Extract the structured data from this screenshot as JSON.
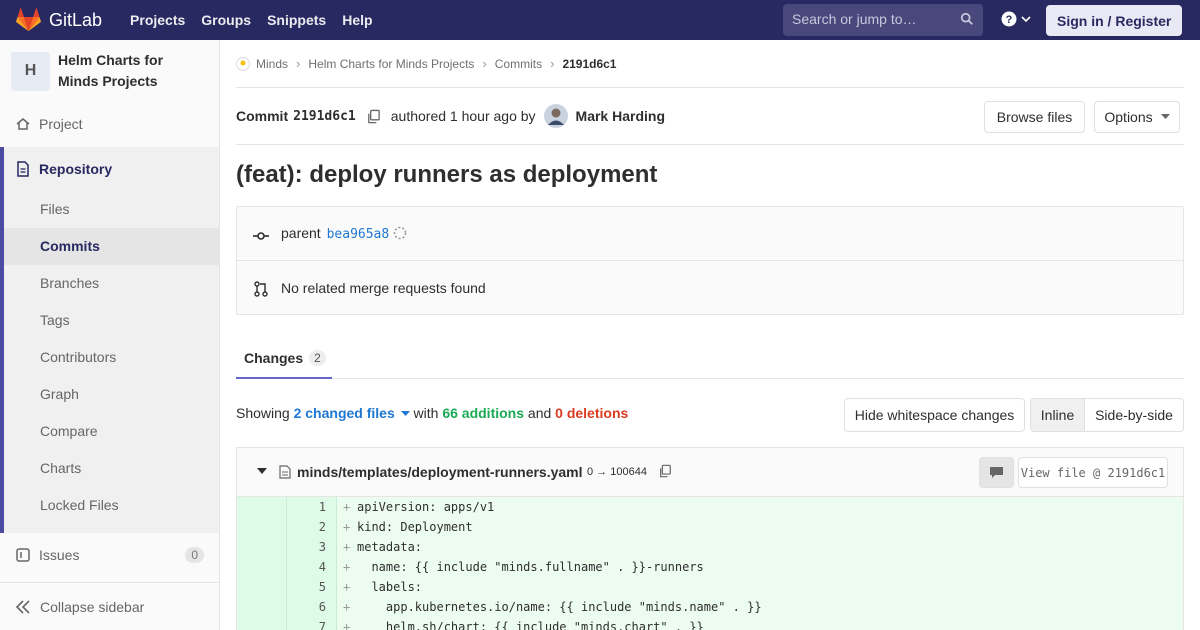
{
  "navbar": {
    "brand": "GitLab",
    "links": [
      "Projects",
      "Groups",
      "Snippets",
      "Help"
    ],
    "search_placeholder": "Search or jump to…",
    "sign_in": "Sign in / Register",
    "brand_color": "#292961"
  },
  "sidebar": {
    "avatar_letter": "H",
    "project_name": "Helm Charts for Minds Projects",
    "project_item": "Project",
    "repository": "Repository",
    "repo_items": [
      "Files",
      "Commits",
      "Branches",
      "Tags",
      "Contributors",
      "Graph",
      "Compare",
      "Charts",
      "Locked Files"
    ],
    "active_item": "Commits",
    "issues": "Issues",
    "issues_count": "0",
    "collapse": "Collapse sidebar"
  },
  "breadcrumb": [
    "Minds",
    "Helm Charts for Minds Projects",
    "Commits",
    "2191d6c1"
  ],
  "commit": {
    "label": "Commit",
    "sha": "2191d6c1",
    "authored": "authored 1 hour ago by",
    "author": "Mark Harding",
    "browse_files": "Browse files",
    "options": "Options",
    "title": "(feat): deploy runners as deployment",
    "parent_label": "parent",
    "parent_sha": "bea965a8",
    "merge_requests": "No related merge requests found"
  },
  "tabs": {
    "changes_label": "Changes",
    "changes_count": "2"
  },
  "summary": {
    "showing": "Showing",
    "changed_files": "2 changed files",
    "with": "with",
    "additions": "66 additions",
    "and": "and",
    "deletions": "0 deletions",
    "hide_whitespace": "Hide whitespace changes",
    "inline": "Inline",
    "side_by_side": "Side-by-side"
  },
  "file": {
    "path": "minds/templates/deployment-runners.yaml",
    "mode": "0 → 100644",
    "view_file": "View file @ 2191d6c1"
  },
  "diff_lines": [
    {
      "n": "1",
      "code": "apiVersion: apps/v1"
    },
    {
      "n": "2",
      "code": "kind: Deployment"
    },
    {
      "n": "3",
      "code": "metadata:"
    },
    {
      "n": "4",
      "code": "  name: {{ include \"minds.fullname\" . }}-runners"
    },
    {
      "n": "5",
      "code": "  labels:"
    },
    {
      "n": "6",
      "code": "    app.kubernetes.io/name: {{ include \"minds.name\" . }}"
    },
    {
      "n": "7",
      "code": "    helm.sh/chart: {{ include \"minds.chart\" . }}"
    }
  ]
}
